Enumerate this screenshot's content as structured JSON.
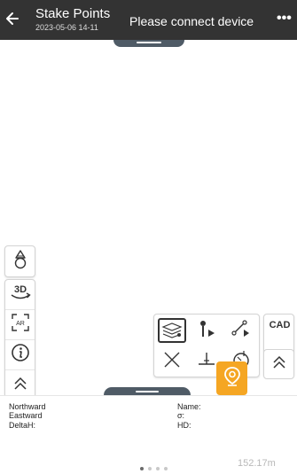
{
  "header": {
    "title": "Stake Points",
    "subtitle": "2023-05-06 14-11",
    "status": "Please connect device",
    "more": "•••"
  },
  "left_toolbar": {
    "icons": [
      "compass-icon",
      "3d-view-icon",
      "ar-icon",
      "info-icon",
      "expand-up-icon"
    ],
    "three_d_label": "3D",
    "ar_label": "AR"
  },
  "stake_tools": {
    "icons": [
      "layers-icon",
      "stake-point-icon",
      "stake-line-icon",
      "intersection-icon",
      "offset-icon",
      "circle-stake-icon"
    ]
  },
  "right_toolbar": {
    "cad_label": "CAD"
  },
  "info_panel": {
    "northward_label": "Northward",
    "eastward_label": "Eastward",
    "deltah_label": "DeltaH:",
    "name_label": "Name:",
    "sigma_label": "σ:",
    "hd_label": "HD:",
    "distance": "152.17m"
  },
  "pagination": {
    "count": 4,
    "active_index": 0
  },
  "colors": {
    "topbar": "#333333",
    "accent": "#f5a623",
    "pulltab": "#4f5b66"
  }
}
